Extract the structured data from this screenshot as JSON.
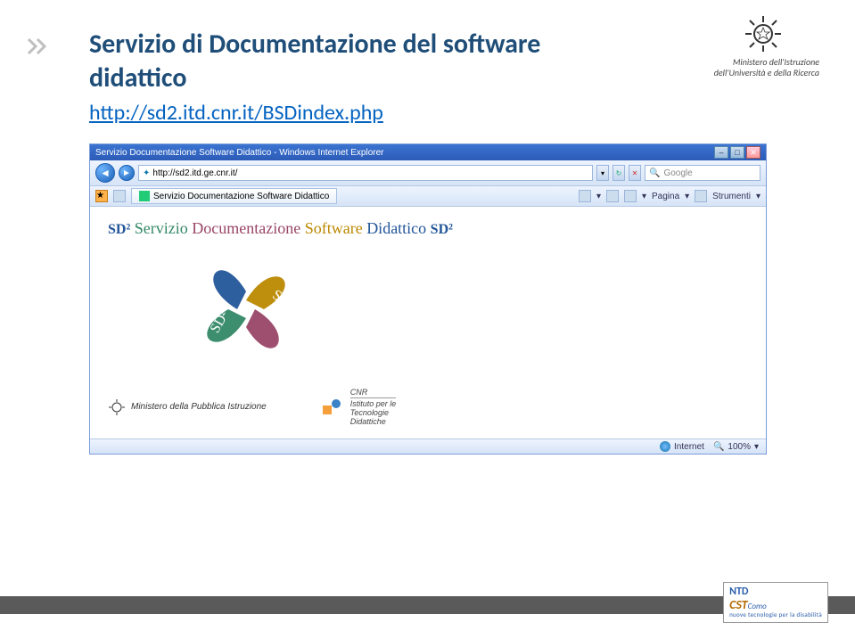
{
  "header": {
    "emblem_ministry_line1": "Ministero dell'Istruzione",
    "emblem_ministry_line2": "dell'Università e della Ricerca"
  },
  "title_line1": "Servizio di Documentazione del software",
  "title_line2": "didattico",
  "link_text": " http://sd2.itd.cnr.it/BSDindex.php",
  "browser": {
    "window_title": "Servizio Documentazione Software Didattico - Windows Internet Explorer",
    "address": "http://sd2.itd.ge.cnr.it/",
    "search_placeholder": "Google",
    "tab_label": "Servizio Documentazione Software Didattico",
    "toolbar": {
      "home": "",
      "feed": "",
      "print": "",
      "page_label": "Pagina",
      "tools_label": "Strumenti"
    },
    "content": {
      "sd2_word1": "Servizio",
      "sd2_word2": "Documentazione",
      "sd2_word3": "Software",
      "sd2_word4": "Didattico",
      "ministero": "Ministero della Pubblica Istruzione",
      "cnr": "CNR",
      "itd_line1": "Istituto per le",
      "itd_line2": "Tecnologie",
      "itd_line3": "Didattiche"
    },
    "status": {
      "zone": "Internet",
      "zoom": "100%"
    }
  },
  "footer": {
    "ntd": "NTD",
    "cst": "CST",
    "como": "Como",
    "sub": "nuove tecnologie per la disabilità"
  }
}
